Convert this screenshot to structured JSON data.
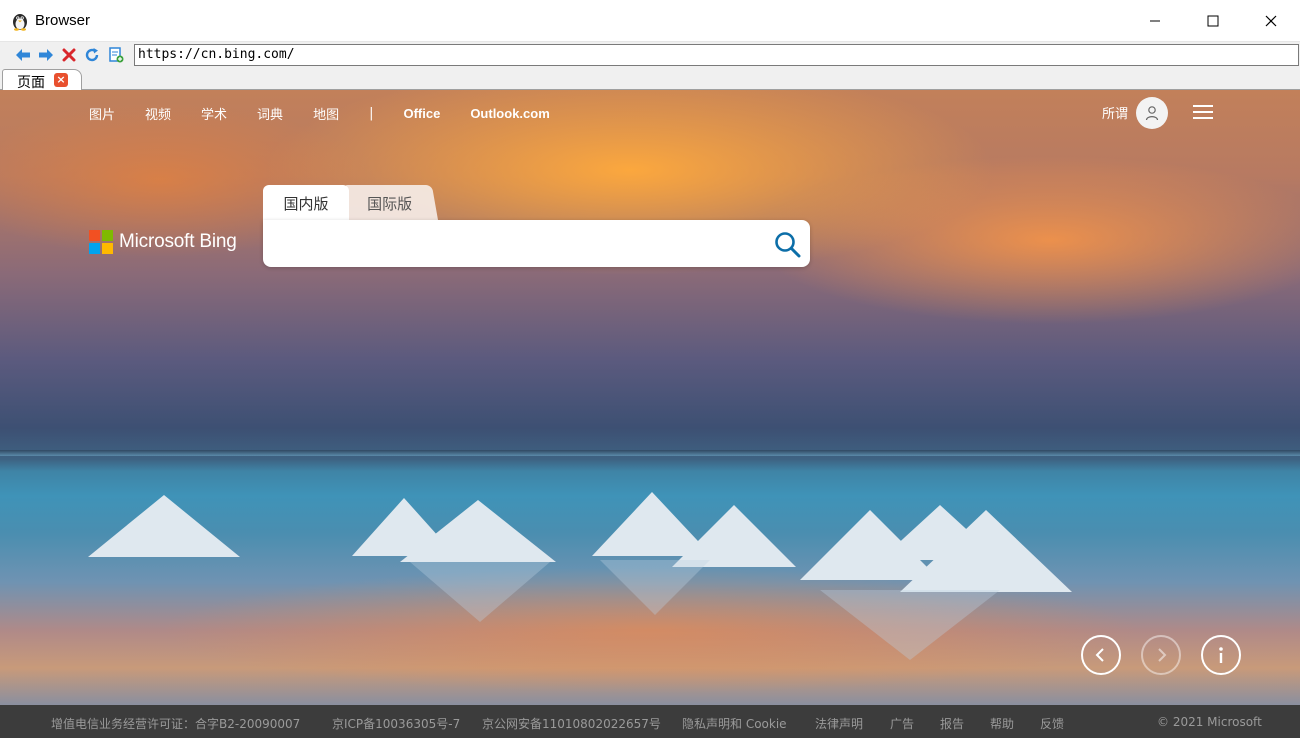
{
  "window": {
    "title": "Browser"
  },
  "toolbar": {
    "url": "https://cn.bing.com/"
  },
  "tabs": [
    {
      "label": "页面"
    }
  ],
  "nav": {
    "links": [
      "图片",
      "视频",
      "学术",
      "词典",
      "地图"
    ],
    "separator": "|",
    "office": "Office",
    "outlook": "Outlook.com",
    "user_label": "所谓"
  },
  "brand": {
    "logo_text": "Microsoft Bing"
  },
  "search": {
    "tabs": [
      "国内版",
      "国际版"
    ],
    "active_tab": "国内版",
    "value": ""
  },
  "footer": {
    "items": [
      "增值电信业务经营许可证：合字B2-20090007",
      "京ICP备10036305号-7",
      "京公网安备11010802022657号",
      "隐私声明和 Cookie",
      "法律声明",
      "广告",
      "报告",
      "帮助",
      "反馈"
    ],
    "copyright": "© 2021 Microsoft"
  },
  "icons": {
    "back": "arrow-left-icon",
    "forward": "arrow-right-icon",
    "stop": "close-x-icon",
    "refresh": "refresh-icon",
    "bookmark": "page-add-icon"
  },
  "colors": {
    "search_icon": "#0c6ea8",
    "tab_close": "#e8502e",
    "footer_bg": "#3c3c3c",
    "footer_text": "#9a9a9a"
  }
}
